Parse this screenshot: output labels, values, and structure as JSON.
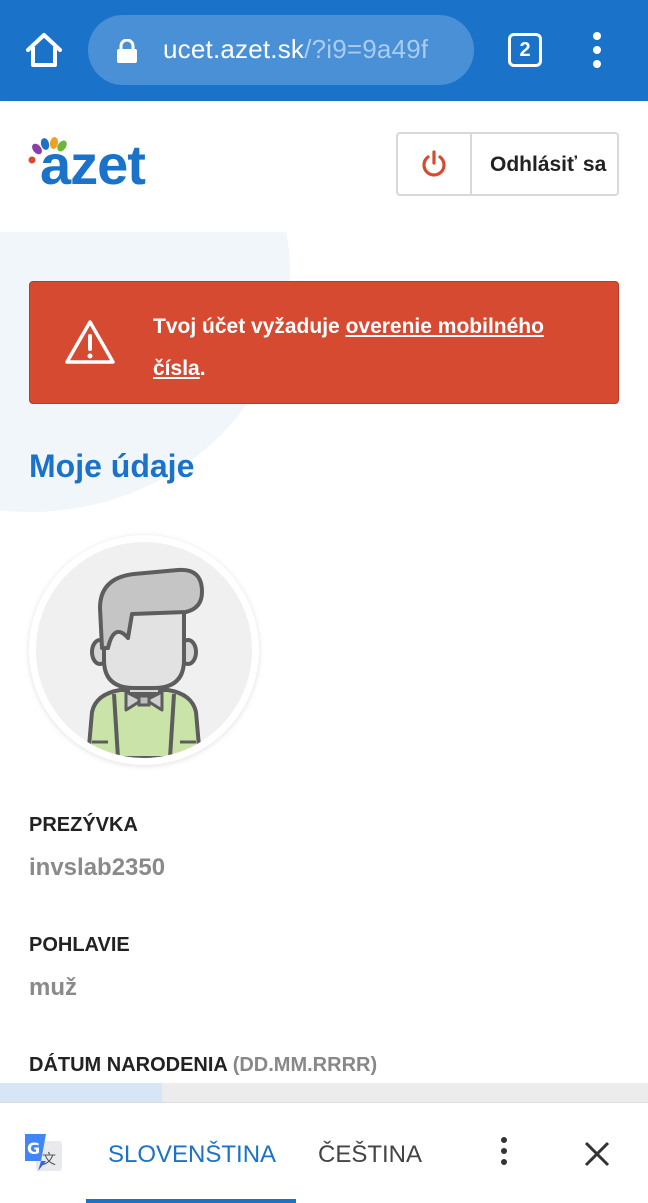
{
  "browser": {
    "url_host": "ucet.azet.sk",
    "url_path": "/?i9=9a49f",
    "tab_count": "2",
    "icons": [
      "home-icon",
      "lock-icon",
      "tab-switcher-icon",
      "overflow-menu-icon"
    ]
  },
  "header": {
    "logo_text": "azet",
    "logout_label": "Odhlásiť sa",
    "logout_icon": "power-icon"
  },
  "alert": {
    "text_before": "Tvoj účet vyžaduje ",
    "link_text": "overenie mobilného čísla",
    "text_after": ".",
    "icon": "warning-icon",
    "color": "#d64a32"
  },
  "profile": {
    "title": "Moje údaje",
    "fields": [
      {
        "label": "PREZÝVKA",
        "value": "invslab2350"
      },
      {
        "label": "POHLAVIE",
        "value": "muž"
      },
      {
        "label": "DÁTUM NARODENIA",
        "hint": "(DD.MM.RRRR)"
      }
    ]
  },
  "page_load_progress": 0.25,
  "translate_bar": {
    "active_language": "SLOVENŠTINA",
    "other_language": "ČEŠTINA",
    "icons": [
      "google-translate-icon",
      "more-options-icon",
      "close-icon"
    ]
  },
  "colors": {
    "brand_blue": "#1a73c8",
    "alert_red": "#d64a32",
    "power_red": "#d64a32"
  }
}
